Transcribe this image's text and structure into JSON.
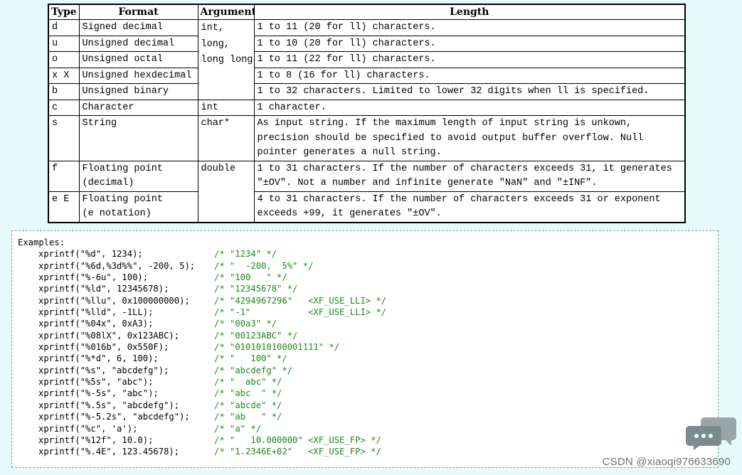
{
  "table": {
    "headers": [
      "Type",
      "Format",
      "Argument",
      "Length"
    ],
    "rows": [
      {
        "type": "d",
        "format": "Signed  decimal",
        "length": [
          "1 to 11 (20 for ll) characters."
        ]
      },
      {
        "type": "u",
        "format": "Unsigned  decimal",
        "length": [
          "1 to 10 (20 for ll) characters."
        ]
      },
      {
        "type": "o",
        "format": "Unsigned  octal",
        "length": [
          "1 to 11 (22 for ll) characters."
        ]
      },
      {
        "type": "x X",
        "format": "Unsigned  hexdecimal",
        "length": [
          "1 to 8 (16 for ll) characters."
        ]
      },
      {
        "type": "b",
        "format": "Unsigned  binary",
        "length": [
          "1 to 32 characters. Limited to lower 32 digits when ll is specified."
        ]
      },
      {
        "type": "c",
        "format": "Character",
        "argument": "int",
        "length": [
          "1 character."
        ]
      },
      {
        "type": "s",
        "format": "String",
        "argument": "char*",
        "length": [
          "As input string. If the maximum length of input string is unkown,",
          "precision should be specified to avoid output buffer overflow. Null",
          "pointer generates a null string."
        ]
      },
      {
        "type": "f",
        "format": [
          "Floating point",
          "(decimal)"
        ],
        "argument": "double",
        "length": [
          "1 to 31 characters. If the number of characters exceeds 31, it generates",
          "\"±OV\". Not a number and infinite generate \"NaN\" and \"±INF\"."
        ]
      },
      {
        "type": "e E",
        "format": [
          "Floating point",
          "(e notation)"
        ],
        "length": [
          "4 to 31 characters. If the number of characters exceeds 31 or exponent",
          "exceeds +99, it generates \"±OV\"."
        ]
      }
    ],
    "int_argument": [
      "int,",
      "long,",
      "long long"
    ]
  },
  "examples": {
    "title": "Examples:",
    "lines": [
      {
        "code": "xprintf(\"%d\", 1234);",
        "comment": "/* \"1234\" */"
      },
      {
        "code": "xprintf(\"%6d,%3d%%\", -200, 5);",
        "comment": "/* \"  -200,  5%\" */"
      },
      {
        "code": "xprintf(\"%-6u\", 100);",
        "comment": "/* \"100   \" */"
      },
      {
        "code": "xprintf(\"%ld\", 12345678);",
        "comment": "/* \"12345678\" */"
      },
      {
        "code": "xprintf(\"%llu\", 0x100000000);",
        "comment": "/* \"4294967296\"   <XF_USE_LLI> */"
      },
      {
        "code": "xprintf(\"%lld\", -1LL);",
        "comment": "/* \"-1\"           <XF_USE_LLI> */"
      },
      {
        "code": "xprintf(\"%04x\", 0xA3);",
        "comment": "/* \"00a3\" */"
      },
      {
        "code": "xprintf(\"%08lX\", 0x123ABC);",
        "comment": "/* \"00123ABC\" */"
      },
      {
        "code": "xprintf(\"%016b\", 0x550F);",
        "comment": "/* \"0101010100001111\" */"
      },
      {
        "code": "xprintf(\"%*d\", 6, 100);",
        "comment": "/* \"   100\" */"
      },
      {
        "code": "xprintf(\"%s\", \"abcdefg\");",
        "comment": "/* \"abcdefg\" */"
      },
      {
        "code": "xprintf(\"%5s\", \"abc\");",
        "comment": "/* \"  abc\" */"
      },
      {
        "code": "xprintf(\"%-5s\", \"abc\");",
        "comment": "/* \"abc  \" */"
      },
      {
        "code": "xprintf(\"%.5s\", \"abcdefg\");",
        "comment": "/* \"abcde\" */"
      },
      {
        "code": "xprintf(\"%-5.2s\", \"abcdefg\");",
        "comment": "/* \"ab   \" */"
      },
      {
        "code": "xprintf(\"%c\", 'a');",
        "comment": "/* \"a\" */"
      },
      {
        "code": "xprintf(\"%12f\", 10.0);",
        "comment": "/* \"   10.000000\" <XF_USE_FP> */"
      },
      {
        "code": "xprintf(\"%.4E\", 123.45678);",
        "comment": "/* \"1.2346E+02\"   <XF_USE_FP> */"
      }
    ]
  },
  "watermark": "CSDN @xiaoqi976633690",
  "icon": {
    "name": "chat-bubble-icon",
    "color": "#7d8a8f"
  }
}
